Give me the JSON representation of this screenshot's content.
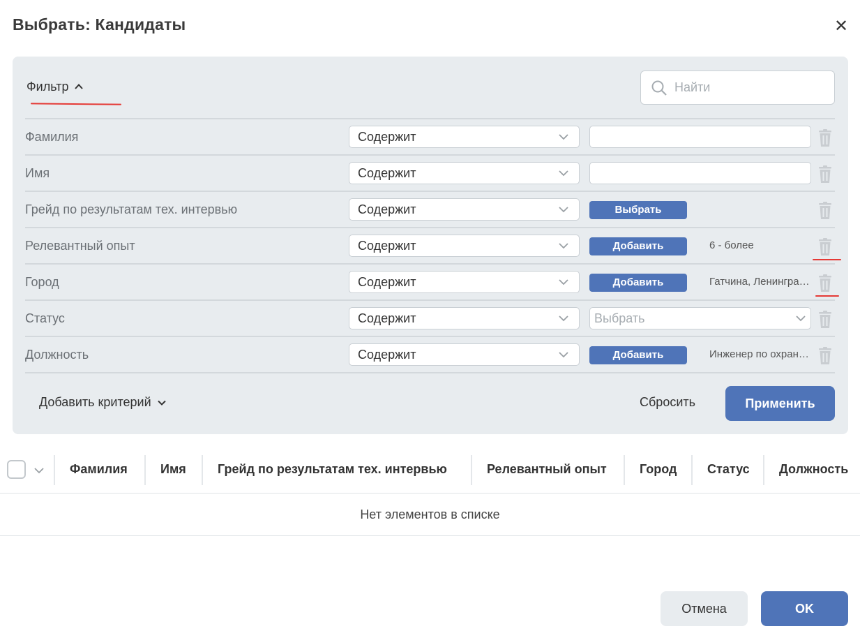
{
  "dialog": {
    "title": "Выбрать: Кандидаты",
    "close_icon": "close-icon"
  },
  "filter": {
    "toggle_label": "Фильтр",
    "expanded": true,
    "search_placeholder": "Найти",
    "rows": [
      {
        "label": "Фамилия",
        "condition": "Содержит",
        "value_type": "input",
        "value": ""
      },
      {
        "label": "Имя",
        "condition": "Содержит",
        "value_type": "input",
        "value": ""
      },
      {
        "label": "Грейд по результатам тех. интервью",
        "condition": "Содержит",
        "value_type": "button",
        "button_label": "Выбрать",
        "value": ""
      },
      {
        "label": "Релевантный опыт",
        "condition": "Содержит",
        "value_type": "button",
        "button_label": "Добавить",
        "value": "6 - более"
      },
      {
        "label": "Город",
        "condition": "Содержит",
        "value_type": "button",
        "button_label": "Добавить",
        "value": "Гатчина, Ленинградская область"
      },
      {
        "label": "Статус",
        "condition": "Содержит",
        "value_type": "select",
        "placeholder": "Выбрать"
      },
      {
        "label": "Должность",
        "condition": "Содержит",
        "value_type": "button",
        "button_label": "Добавить",
        "value": "Инженер по охране труда"
      }
    ],
    "add_criterion_label": "Добавить критерий",
    "reset_label": "Сбросить",
    "apply_label": "Применить"
  },
  "table": {
    "columns": [
      "Фамилия",
      "Имя",
      "Грейд по результатам тех. интервью",
      "Релевантный опыт",
      "Город",
      "Статус",
      "Должность"
    ],
    "empty_message": "Нет элементов в списке"
  },
  "footer": {
    "cancel_label": "Отмена",
    "ok_label": "OK"
  },
  "colors": {
    "primary": "#4f74b8",
    "panel_bg": "#e8ecef",
    "annotation": "#e53935"
  }
}
